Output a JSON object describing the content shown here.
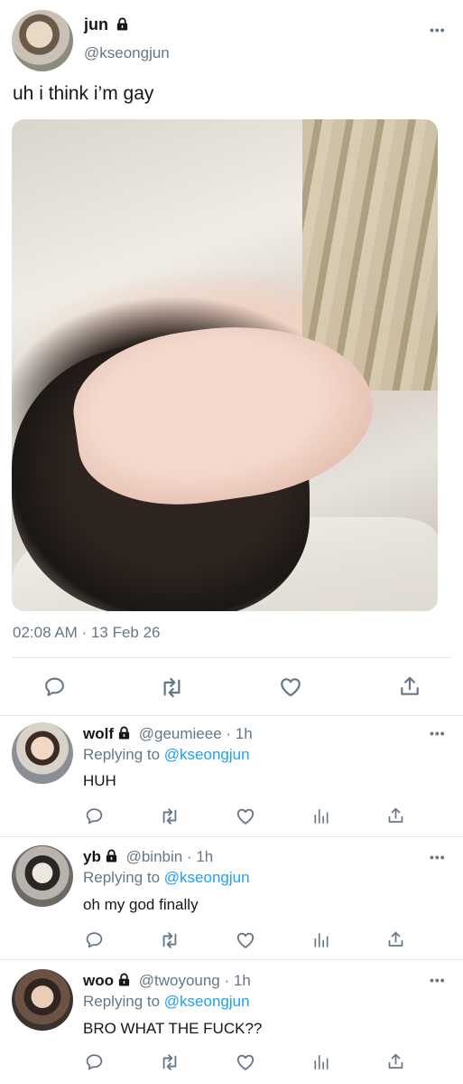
{
  "tweet": {
    "author_name": "jun",
    "author_handle": "@kseongjun",
    "text": "uh i think i’m gay",
    "timestamp": "02:08 AM · 13 Feb 26",
    "more_label": "•••"
  },
  "replies": [
    {
      "name": "wolf",
      "handle_time": "@geumieee · 1h",
      "replying_prefix": "Replying to ",
      "replying_to": "@kseongjun",
      "text": "HUH",
      "more_label": "•••"
    },
    {
      "name": "yb",
      "handle_time": "@binbin · 1h",
      "replying_prefix": "Replying to ",
      "replying_to": "@kseongjun",
      "text": "oh my god finally",
      "more_label": "•••"
    },
    {
      "name": "woo",
      "handle_time": "@twoyoung · 1h",
      "replying_prefix": "Replying to ",
      "replying_to": "@kseongjun",
      "text": "BRO WHAT THE FUCK??",
      "more_label": "•••"
    }
  ],
  "icons": {
    "reply": "reply-icon",
    "retweet": "retweet-icon",
    "like": "heart-icon",
    "stats": "bar-chart-icon",
    "share": "share-icon",
    "lock": "lock-icon"
  },
  "colors": {
    "link": "#1da1f2",
    "secondary": "#657786",
    "text": "#14171a",
    "divider": "#e1e8ed"
  }
}
